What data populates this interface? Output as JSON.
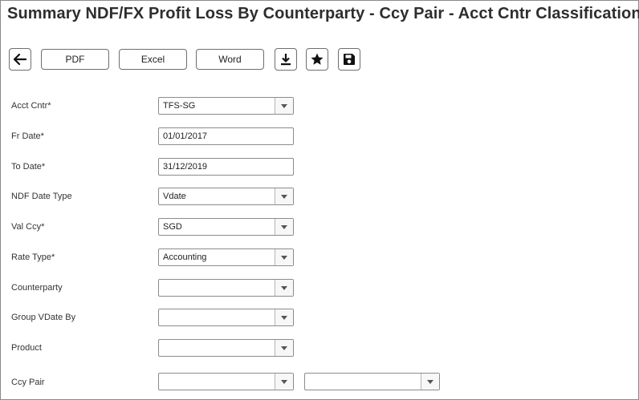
{
  "title": "Summary NDF/FX Profit Loss By Counterparty - Ccy Pair - Acct Cntr Classification",
  "toolbar": {
    "back_icon": "arrow-left-icon",
    "pdf_label": "PDF",
    "excel_label": "Excel",
    "word_label": "Word",
    "download_icon": "download-icon",
    "favorite_icon": "star-icon",
    "save_icon": "floppy-disk-icon"
  },
  "form": {
    "acct_cntr": {
      "label": "Acct Cntr*",
      "value": "TFS-SG"
    },
    "fr_date": {
      "label": "Fr Date*",
      "value": "01/01/2017"
    },
    "to_date": {
      "label": "To Date*",
      "value": "31/12/2019"
    },
    "ndf_date_type": {
      "label": "NDF Date Type",
      "value": "Vdate"
    },
    "val_ccy": {
      "label": "Val Ccy*",
      "value": "SGD"
    },
    "rate_type": {
      "label": "Rate Type*",
      "value": "Accounting"
    },
    "counterparty": {
      "label": "Counterparty",
      "value": ""
    },
    "group_vdate_by": {
      "label": "Group VDate By",
      "value": ""
    },
    "product": {
      "label": "Product",
      "value": ""
    },
    "ccy_pair": {
      "label": "Ccy Pair",
      "value_1": "",
      "value_2": ""
    }
  }
}
